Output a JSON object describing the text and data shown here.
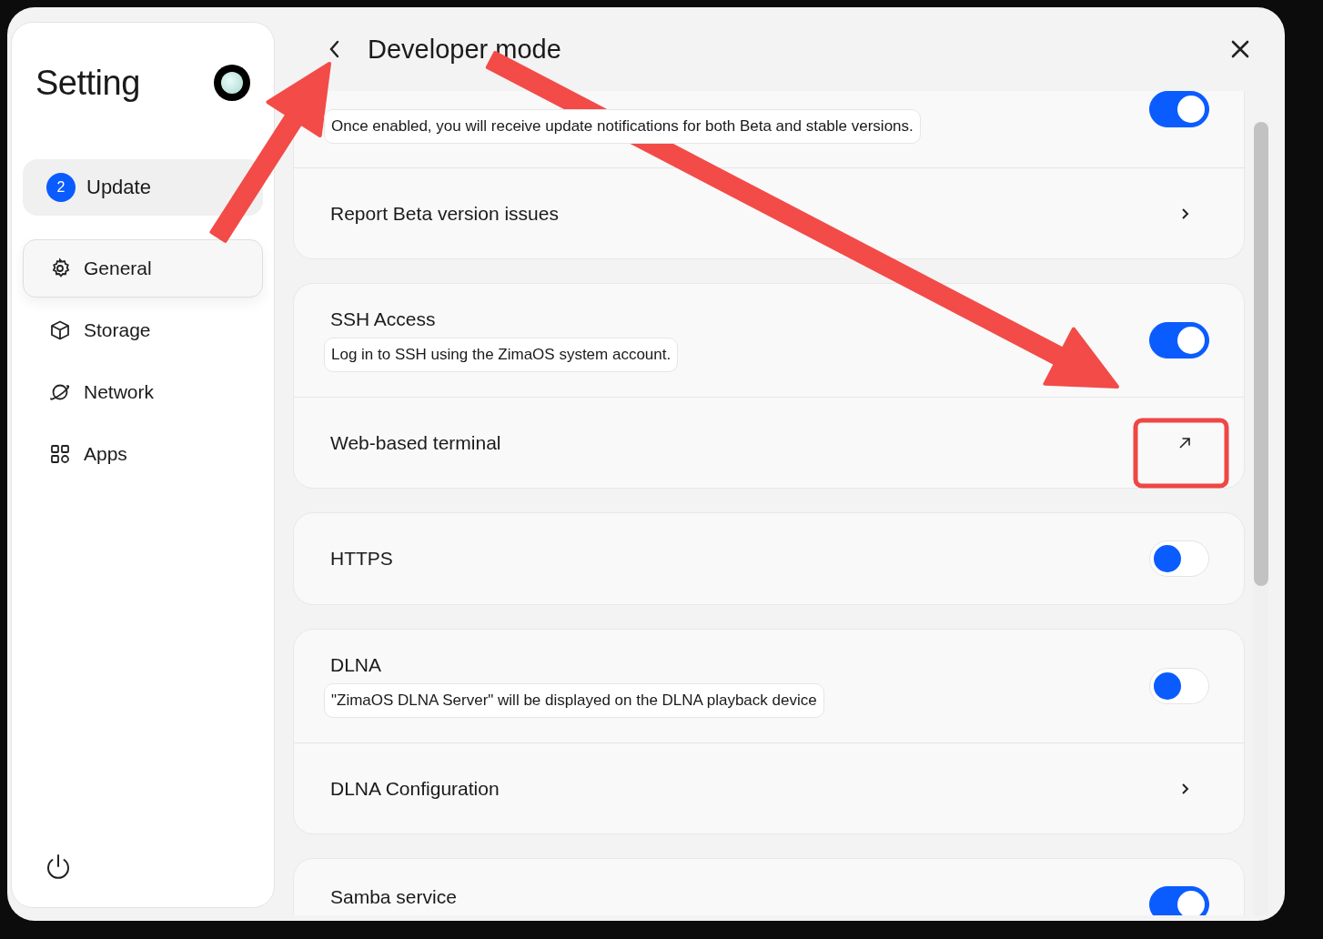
{
  "sidebar": {
    "title": "Setting",
    "update": {
      "badge": "2",
      "label": "Update"
    },
    "items": [
      {
        "label": "General",
        "selected": true
      },
      {
        "label": "Storage",
        "selected": false
      },
      {
        "label": "Network",
        "selected": false
      },
      {
        "label": "Apps",
        "selected": false
      }
    ]
  },
  "header": {
    "title": "Developer mode"
  },
  "cards": [
    {
      "rows": [
        {
          "kind": "toggle",
          "description": "Once enabled, you will receive update notifications for both Beta and stable versions.",
          "on": true
        },
        {
          "kind": "link",
          "title": "Report Beta version issues"
        }
      ]
    },
    {
      "rows": [
        {
          "kind": "toggle",
          "title": "SSH Access",
          "description": "Log in to SSH using the ZimaOS system account.",
          "on": true
        },
        {
          "kind": "external",
          "title": "Web-based terminal"
        }
      ]
    },
    {
      "rows": [
        {
          "kind": "toggle",
          "title": "HTTPS",
          "on": false
        }
      ]
    },
    {
      "rows": [
        {
          "kind": "toggle",
          "title": "DLNA",
          "description": "\"ZimaOS DLNA Server\" will be displayed on the DLNA playback device",
          "on": false
        },
        {
          "kind": "link",
          "title": "DLNA Configuration"
        }
      ]
    },
    {
      "rows": [
        {
          "kind": "toggle",
          "title": "Samba service",
          "on": true
        }
      ]
    }
  ],
  "annotations": [
    {
      "kind": "arrow"
    },
    {
      "kind": "arrow"
    },
    {
      "kind": "frame"
    }
  ]
}
